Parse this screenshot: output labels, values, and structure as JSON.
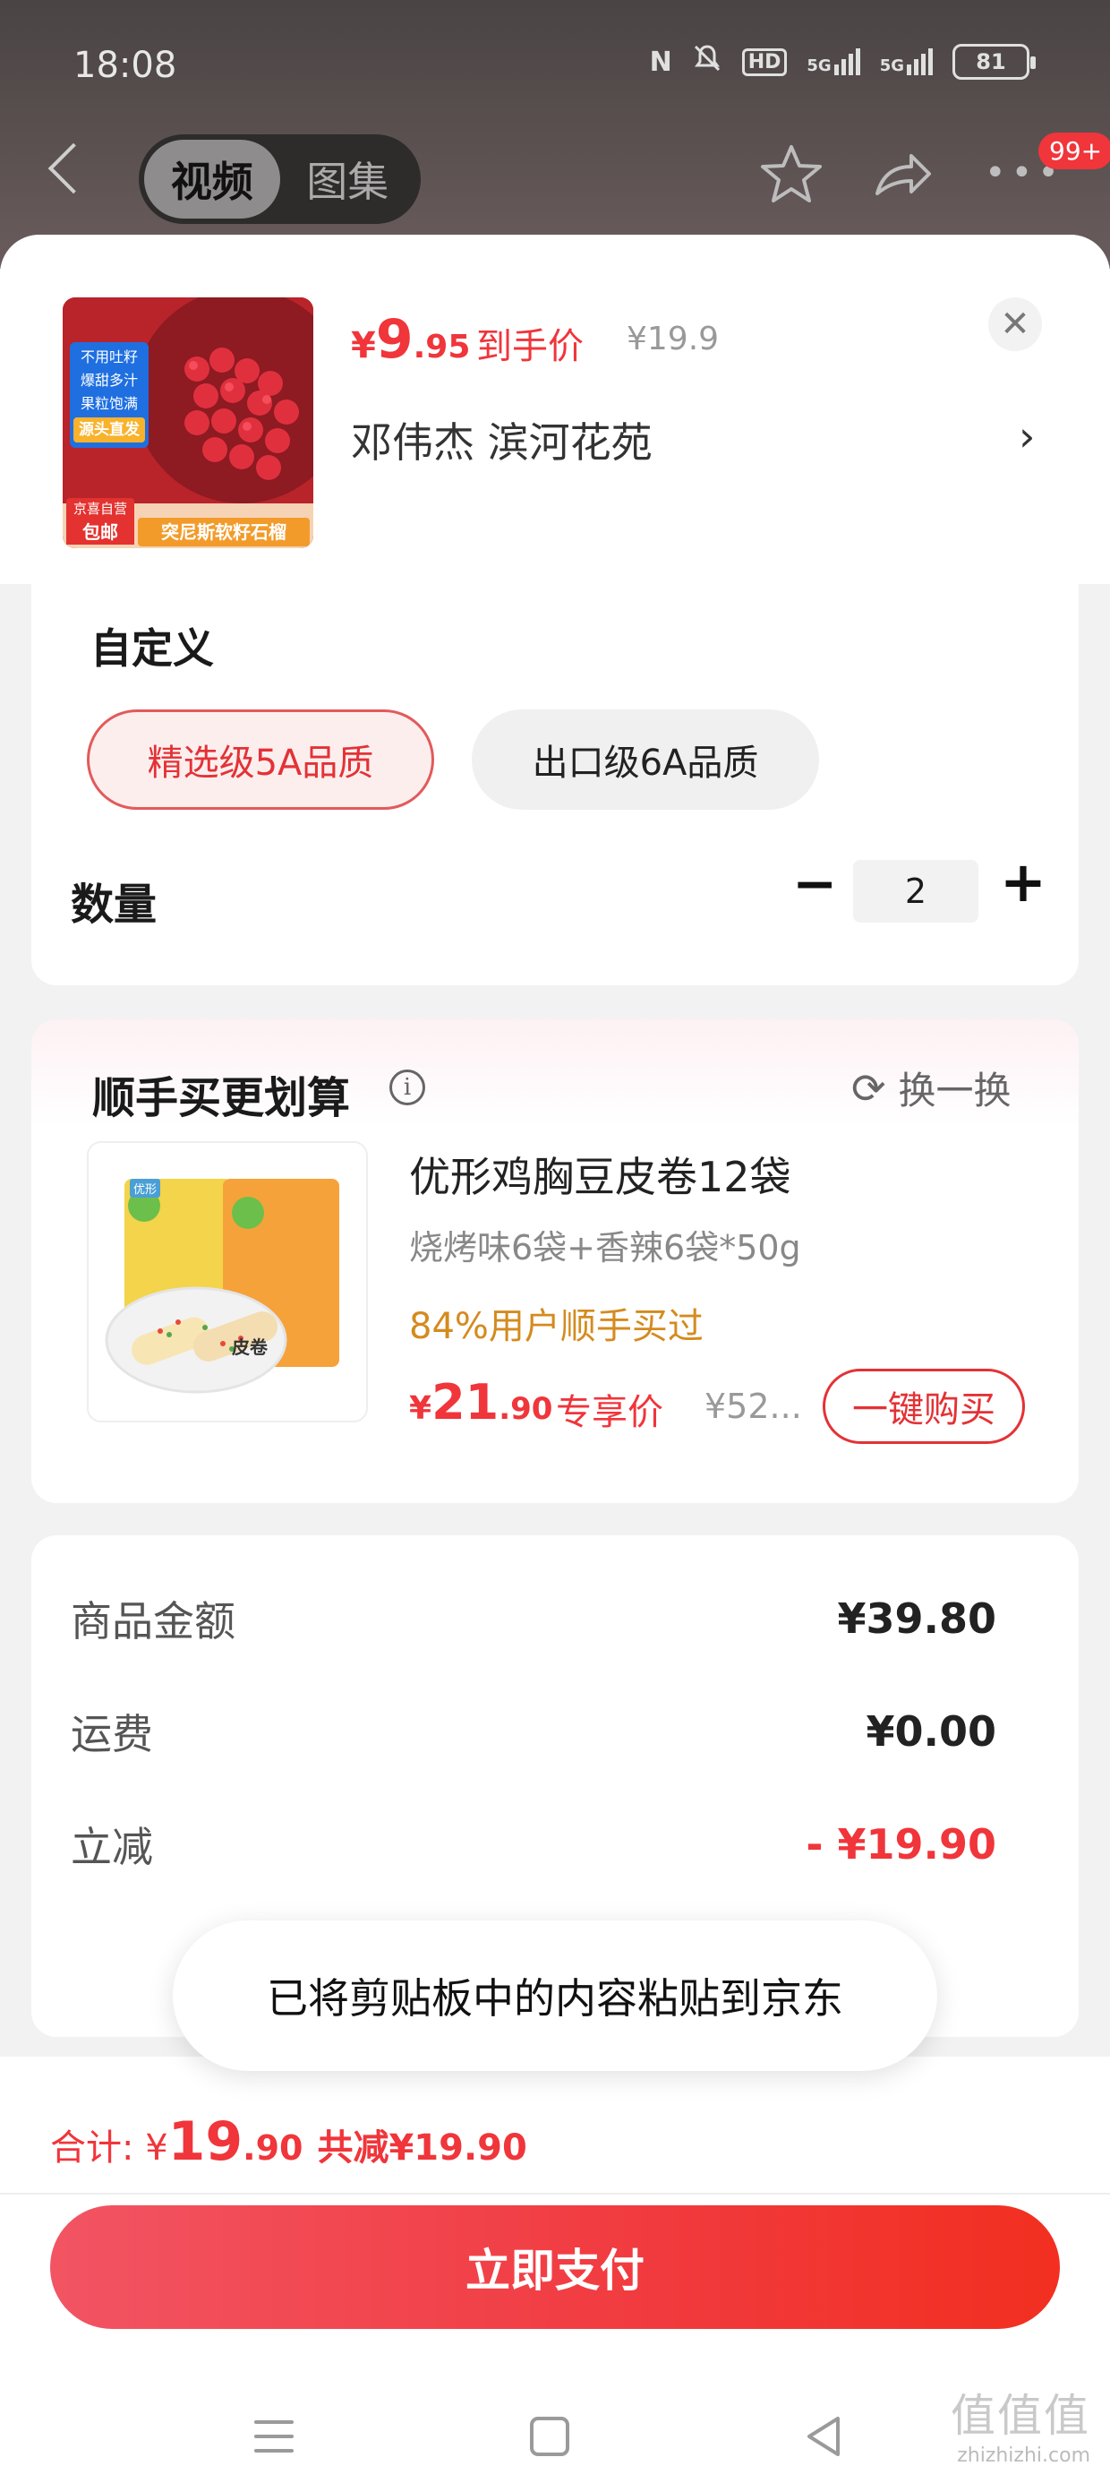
{
  "status_bar": {
    "time": "18:08",
    "icons": [
      "nfc-icon",
      "mute-icon",
      "hd-icon",
      "signal-5g-icon",
      "signal-5g-2-icon"
    ],
    "hd_label": "HD",
    "net1": "5G",
    "net2": "5G",
    "battery": "81"
  },
  "top_nav": {
    "tabs": [
      {
        "label": "视频"
      },
      {
        "label": "图集"
      }
    ],
    "badge": "99+"
  },
  "product": {
    "price_symbol": "¥",
    "price_int": "9",
    "price_dec": ".95",
    "price_tag": "到手价",
    "original_price": "¥19.9",
    "address": "邓伟杰  滨河花苑",
    "image_labels": [
      "不用吐籽",
      "爆甜多汁",
      "果粒饱满",
      "源头直发",
      "京喜自营",
      "包邮",
      "突尼斯软籽石榴"
    ]
  },
  "spec": {
    "title": "自定义",
    "options": [
      {
        "label": "精选级5A品质",
        "selected": true
      },
      {
        "label": "出口级6A品质",
        "selected": false
      }
    ],
    "qty_label": "数量",
    "qty_value": "2"
  },
  "recommend": {
    "title": "顺手买更划算",
    "refresh_label": "换一换",
    "item": {
      "name": "优形鸡胸豆皮卷12袋",
      "desc": "烧烤味6袋+香辣6袋*50g",
      "social": "84%用户顺手买过",
      "price_symbol": "¥",
      "price_int": "21",
      "price_dec": ".90",
      "price_tag": "专享价",
      "original_price": "¥52...",
      "buy_label": "一键购买",
      "image_labels": [
        "优形",
        "皮卷"
      ]
    }
  },
  "summary": {
    "rows": [
      {
        "label": "商品金额",
        "value": "¥39.80"
      },
      {
        "label": "运费",
        "value": "¥0.00"
      },
      {
        "label": "立减",
        "value": "- ¥19.90"
      }
    ]
  },
  "toast": "已将剪贴板中的内容粘贴到京东",
  "footer": {
    "total_label": "合计: ¥",
    "total_int": "19",
    "total_dec": ".90",
    "save_label": "共减¥19.90",
    "pay_label": "立即支付"
  },
  "watermark": {
    "big": "值值值",
    "small": "zhizhizhi.com"
  },
  "colors": {
    "accent": "#f0353b",
    "gold": "#d48b1e",
    "bg": "#f2f2f2"
  }
}
